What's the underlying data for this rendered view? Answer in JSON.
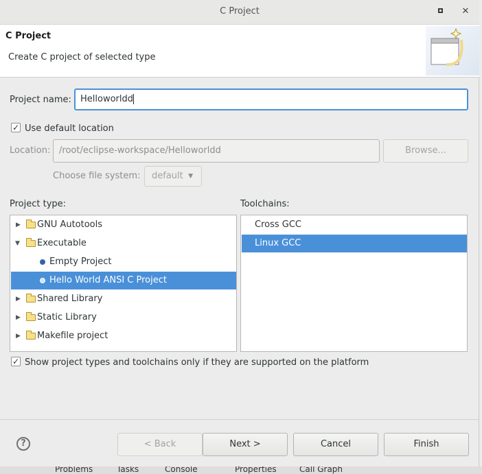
{
  "window": {
    "title": "C Project"
  },
  "header": {
    "title": "C Project",
    "description": "Create C project of selected type"
  },
  "project_name": {
    "label": "Project name:",
    "value": "Helloworldd"
  },
  "location": {
    "use_default_label": "Use default location",
    "use_default_checked": true,
    "label": "Location:",
    "value": "/root/eclipse-workspace/Helloworldd",
    "browse_label": "Browse...",
    "file_system_label": "Choose file system:",
    "file_system_value": "default"
  },
  "project_type": {
    "label": "Project type:",
    "items": [
      {
        "label": "GNU Autotools",
        "kind": "folder",
        "expanded": false
      },
      {
        "label": "Executable",
        "kind": "folder",
        "expanded": true
      },
      {
        "label": "Empty Project",
        "kind": "leaf"
      },
      {
        "label": "Hello World ANSI C Project",
        "kind": "leaf",
        "selected": true
      },
      {
        "label": "Shared Library",
        "kind": "folder",
        "expanded": false
      },
      {
        "label": "Static Library",
        "kind": "folder",
        "expanded": false
      },
      {
        "label": "Makefile project",
        "kind": "folder",
        "expanded": false
      }
    ]
  },
  "toolchains": {
    "label": "Toolchains:",
    "items": [
      {
        "label": "Cross GCC"
      },
      {
        "label": "Linux GCC",
        "selected": true
      }
    ]
  },
  "filter": {
    "label": "Show project types and toolchains only if they are supported on the platform",
    "checked": true
  },
  "buttons": {
    "back": "< Back",
    "next": "Next >",
    "cancel": "Cancel",
    "finish": "Finish",
    "help": "?"
  },
  "background_tabs": [
    "Problems",
    "Tasks",
    "Console",
    "Properties",
    "Call Graph"
  ],
  "colors": {
    "selection": "#4a90d9",
    "focus": "#4a90d9"
  }
}
